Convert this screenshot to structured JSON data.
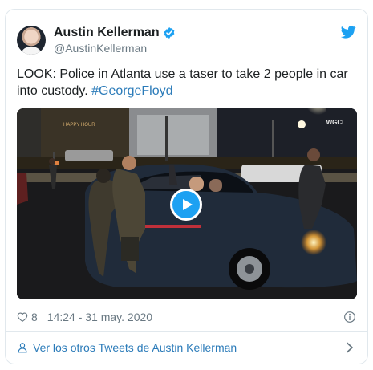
{
  "author": {
    "name": "Austin Kellerman",
    "handle": "@AustinKellerman"
  },
  "tweet": {
    "text": "LOOK: Police in Atlanta use a taser to take 2 people in car into custody. ",
    "hashtag": "#GeorgeFloyd"
  },
  "media": {
    "channel_watermark": "WGCL",
    "sign_text": "HAPPY HOUR"
  },
  "meta": {
    "likes": "8",
    "timestamp": "14:24 - 31 may. 2020"
  },
  "footer": {
    "link_text": "Ver los otros Tweets de Austin Kellerman"
  },
  "colors": {
    "brand_blue": "#1da1f2",
    "link_blue": "#2b7bb9",
    "muted_gray": "#697882"
  }
}
